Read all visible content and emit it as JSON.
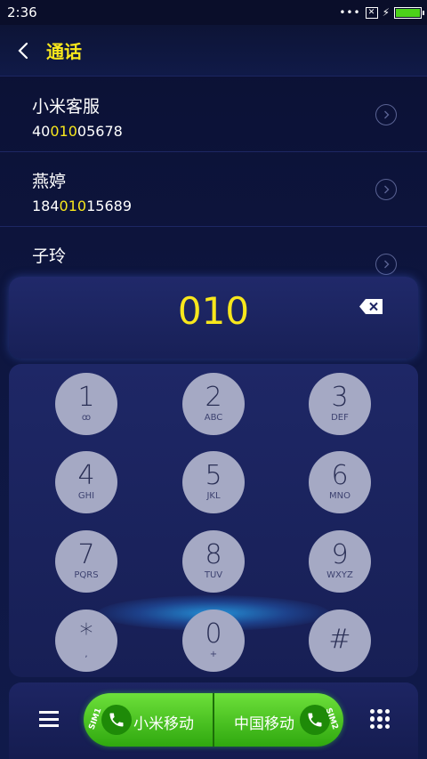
{
  "status": {
    "time": "2:36"
  },
  "header": {
    "title": "通话"
  },
  "contacts": [
    {
      "name": "小米客服",
      "num_pre": "40",
      "num_hl": "010",
      "num_post": "05678"
    },
    {
      "name": "燕婷",
      "num_pre": "184",
      "num_hl": "010",
      "num_post": "15689"
    },
    {
      "name": "子玲",
      "num_pre": "",
      "num_hl": "",
      "num_post": ""
    }
  ],
  "dialer": {
    "digits": "010"
  },
  "keys": [
    {
      "d": "1",
      "l": "ꝏ"
    },
    {
      "d": "2",
      "l": "ABC"
    },
    {
      "d": "3",
      "l": "DEF"
    },
    {
      "d": "4",
      "l": "GHI"
    },
    {
      "d": "5",
      "l": "JKL"
    },
    {
      "d": "6",
      "l": "MNO"
    },
    {
      "d": "7",
      "l": "PQRS"
    },
    {
      "d": "8",
      "l": "TUV"
    },
    {
      "d": "9",
      "l": "WXYZ"
    },
    {
      "d": "*",
      "l": ","
    },
    {
      "d": "0",
      "l": "+"
    },
    {
      "d": "#",
      "l": ""
    }
  ],
  "bottom": {
    "sim1": {
      "tag": "SIM1",
      "label": "小米移动"
    },
    "sim2": {
      "tag": "SIM2",
      "label": "中国移动"
    }
  },
  "colors": {
    "accent": "#f8e71c",
    "call_green": "#3cc21a",
    "key_fill": "#a5a9c4",
    "background": "#0e1640"
  },
  "icons": [
    "back-arrow-icon",
    "chevron-right-icon",
    "backspace-icon",
    "phone-icon",
    "menu-icon",
    "dialpad-grid-icon"
  ]
}
